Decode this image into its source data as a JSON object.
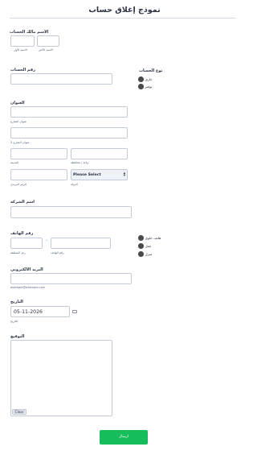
{
  "form": {
    "title": "نموذج إغلاق حساب"
  },
  "owner": {
    "label": "الاسم مالك الحساب",
    "first_sub": "الاسم الأول",
    "last_sub": "الاسم الأخير"
  },
  "account_type": {
    "label": "نوع الحساب",
    "options": [
      "جاري",
      "توفير"
    ]
  },
  "account_number": {
    "label": "رقم الحساب"
  },
  "address": {
    "label": "العنوان",
    "street_sub": "عنوان الشارع",
    "street2_sub": "عنوان الشارع 2",
    "city_sub": "المدينة",
    "state_sub": "ولاية / محافظة",
    "zip_sub": "الرمز البريدي",
    "country_sub": "الدولة",
    "country_value": "Please Select"
  },
  "company": {
    "label": "اسم الشركة"
  },
  "phone": {
    "label": "رقم الهاتف",
    "area_sub": "رمز المنطقة",
    "number_sub": "رقم الهاتف",
    "separator": "-",
    "options": [
      "هاتف خلوي",
      "عمل",
      "منزل"
    ]
  },
  "email": {
    "label": "البريد الالكتروني",
    "sub": "example@example.com"
  },
  "date": {
    "label": "التاريخ",
    "value": "05-11-2026",
    "sub": "التاريخ"
  },
  "signature": {
    "label": "التوقيع",
    "clear_label": "Clear"
  },
  "submit": {
    "label": "ارسال"
  }
}
